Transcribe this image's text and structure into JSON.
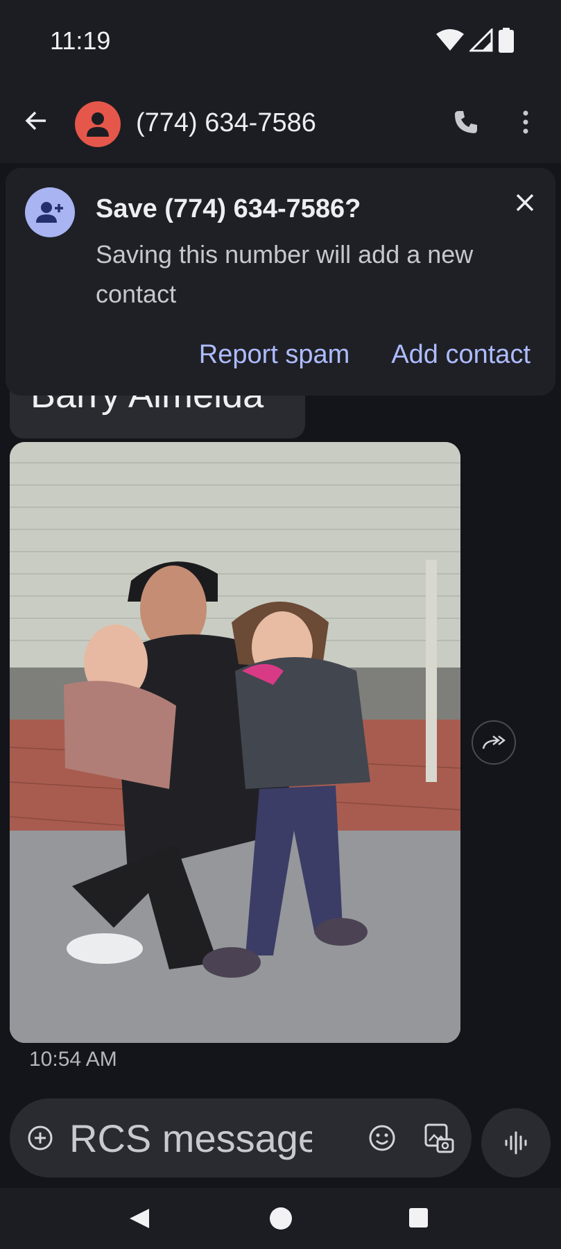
{
  "status_bar": {
    "time": "11:19"
  },
  "app_bar": {
    "title": "(774) 634-7586"
  },
  "banner": {
    "title": "Save (774) 634-7586?",
    "text": "Saving this number will add a new contact",
    "report_label": "Report spam",
    "add_label": "Add contact"
  },
  "messages": {
    "text_bubble": "Barry Almeida",
    "timestamp": "10:54 AM"
  },
  "composer": {
    "placeholder": "RCS message"
  },
  "icons": {
    "back": "arrow-left-icon",
    "call": "phone-icon",
    "more": "more-vert-icon",
    "add_contact": "person-add-icon",
    "close": "close-icon",
    "forward": "forward-icon",
    "attach": "add-circle-icon",
    "emoji": "emoji-icon",
    "gallery": "gallery-icon",
    "voice": "voice-icon"
  },
  "colors": {
    "background": "#14151a",
    "avatar": "#e5574a",
    "accent": "#aebcff",
    "banner_avatar": "#a9b4f2"
  }
}
